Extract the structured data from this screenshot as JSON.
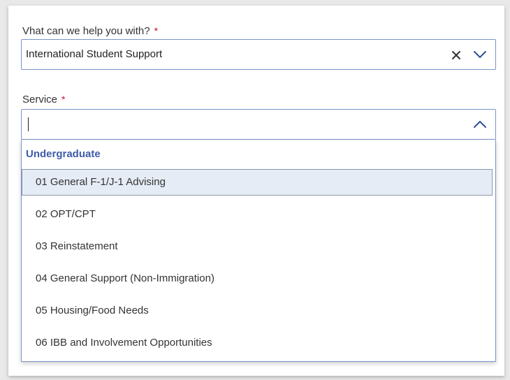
{
  "form": {
    "help_field": {
      "label": "Vhat can we help you with?",
      "required_mark": "*",
      "value": "International Student Support",
      "clear_icon": "close-icon",
      "toggle_icon": "chevron-down-icon"
    },
    "service_field": {
      "label": "Service",
      "required_mark": "*",
      "value": "",
      "toggle_icon": "chevron-up-icon",
      "dropdown": {
        "group_label": "Undergraduate",
        "highlighted_index": 0,
        "options": [
          "01 General F-1/J-1 Advising",
          "02 OPT/CPT",
          "03 Reinstatement",
          "04 General Support (Non-Immigration)",
          "05 Housing/Food Needs",
          "06 IBB and Involvement Opportunities"
        ]
      }
    }
  },
  "colors": {
    "border": "#7a93c9",
    "group_label": "#3f5ba8",
    "required": "#c8102e",
    "highlight_bg": "#e6ecf5"
  }
}
